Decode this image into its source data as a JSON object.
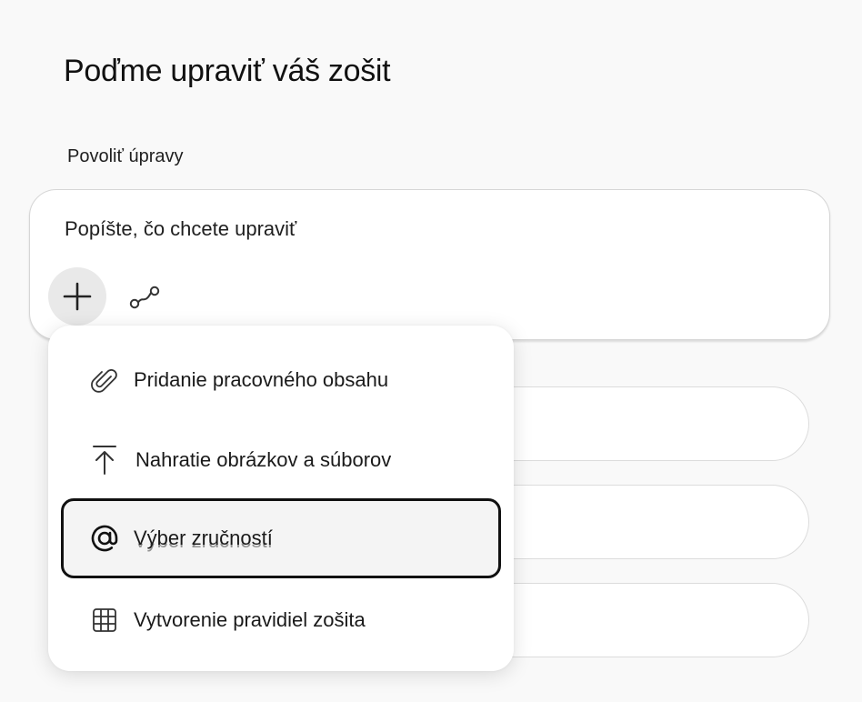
{
  "page": {
    "title": "Poďme upraviť váš zošit",
    "section_label": "Povoliť úpravy"
  },
  "prompt": {
    "placeholder": "Popíšte, čo chcete upraviť",
    "add_icon": "plus-icon",
    "flow_icon": "flow-icon"
  },
  "menu": {
    "items": [
      {
        "label": "Pridanie pracovného obsahu",
        "icon": "paperclip-icon",
        "selected": false
      },
      {
        "label": "Nahratie obrázkov a súborov",
        "icon": "upload-icon",
        "selected": false
      },
      {
        "label": "Výber zručností",
        "icon": "at-sign-icon",
        "selected": true
      },
      {
        "label": "Vytvorenie pravidiel zošita",
        "icon": "grid-icon",
        "selected": false
      }
    ]
  },
  "colors": {
    "background": "#f9f9f9",
    "surface": "#ffffff",
    "selected_border": "#111111",
    "selected_fill": "#f4f4f4"
  }
}
